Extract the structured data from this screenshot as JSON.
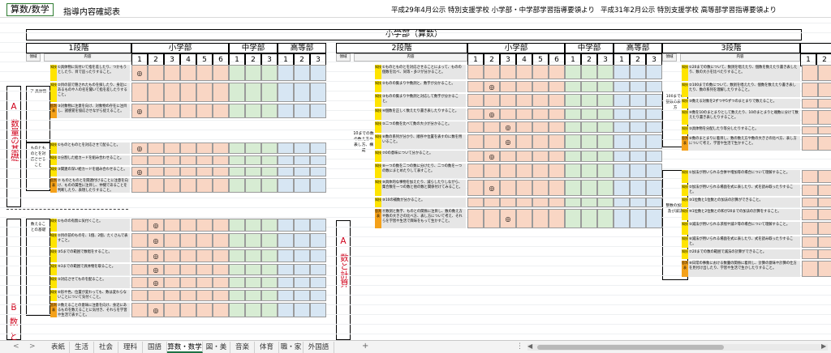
{
  "header": {
    "tab_label": "算数/数学",
    "doc_title": "指導内容確認表",
    "pub1": "平成29年4月公示  特別支援学校  小学部・中学部学習指導要領より",
    "pub2": "平成31年2月公示  特別支援学校  高等部学習指導要領より"
  },
  "banner": "小学部（算数）",
  "stages": [
    "1段階",
    "2段階",
    "3段階"
  ],
  "levels": {
    "elem": "小学部",
    "mid": "中学部",
    "high": "高等部"
  },
  "grades_elem": [
    "1",
    "2",
    "3",
    "4",
    "5",
    "6"
  ],
  "grades_mid": [
    "1",
    "2",
    "3"
  ],
  "grades_high": [
    "1",
    "2",
    "3"
  ],
  "subhead": {
    "domain": "領域",
    "content": "内容"
  },
  "mark": "◎",
  "domains": {
    "a": {
      "letter": "A",
      "text": "数量の基礎"
    },
    "a2": {
      "letter": "A",
      "text": "数と計算"
    },
    "b": {
      "letter": "B",
      "text": "数と"
    }
  },
  "subs": {
    "a_gutai": "ア 具体物",
    "a_mono": "ものとものとを対応させること",
    "a_kazu": "数えることの基礎",
    "s2_kazu": "10までの数の数え方や表し方、構成",
    "s3_kazu": "100までの整数の表し方",
    "s3_keisan": "整数の加法及び減法"
  },
  "labels": {
    "chishiki": "知技",
    "shiko": "思判表"
  },
  "s1": {
    "r1": "①具体物に気付いて指を差したり、つかもうとしたり、目で追ったりすること。",
    "r2": "②目の前で隠されたものを探したり、身近にあるものや人の名を聞いて指を差したりすること。",
    "r3": "③対象物に注意を向け、対象物の存在に注目し、諸感覚を協応させながら捉えること。",
    "r4": "①ものとものとを対応させて配ること。",
    "r5": "②分割した絵カードを組み合わせること。",
    "r6": "③関連の深い絵カードを組み合わせること。",
    "r7": "⑦ ものとものとを関連付けることに注意を向け、ものの属性に注目し、仲間であることを判断したり、表現したりすること。",
    "r8": "①ものの有無に気付くこと。",
    "r9": "②目の前のものを、1個、2個、たくさんで表すこと。",
    "r10": "③5までの範囲で数唱をすること。",
    "r11": "④3までの範囲で具体物を取ること。",
    "r12": "⑤対応させてものを配ること。",
    "r13": "⑥形や色、位置が変わっても、数は変わらないことについて気付くこと。",
    "r14": "⑦数えることの意味に注意を向け、身近にあるものを数えることに気付き、それらを学習や生活で表すこと。"
  },
  "s2": {
    "r1": "①ものとものとを対応させることによって、ものの個数を比べ、同等・多少が分かること。",
    "r2": "②ものの集まりや数詞と、数字が分かること。",
    "r3": "③ものの集まりや数詞と対応して数字が分かること。",
    "r4": "④個数を正しく数えたり書き表したりすること。",
    "r5": "⑤二つの数を比べて数の大小が分かること。",
    "r6": "⑥数の系列が分かり、順序や位置を表すのに数を用いること。",
    "r7": "⑦0の意味について分かること。",
    "r8": "⑧一つの数を二つの数に分けたり、二つの数を一つの数にまとめたりして表すこと。",
    "r9": "⑨具体的な事物を加えたり、減らしたりしながら、集合数を一つの数と他の数と関係付けてみること。",
    "r10": "⑩10の補数が分かること。",
    "r11": "⑪数詞と数字、ものとの関係に注目し、数の数え方や数の大きさの比べ方、表し方について考え、それらを学習や生活で興味をもって生かすこと。"
  },
  "s3": {
    "r1": "①20までの数について、数詞を唱えたり、個数を数えたり書き表したり、数の大小を比べたりすること。",
    "r2": "②100までの数について、数詞を唱えたり、個数を数えたり書き表したり、数の系列を理解したりすること。",
    "r3": "③数える対象を2ずつや5ずつのまとまりで数えること。",
    "r4": "④数を10のまとまりとして数えたり、10のまとまりと端数に分けて数えたり書き表したりすること。",
    "r5": "⑤具体物を分配したり等分したりすること。",
    "r6": "⑥数のまとまりに着目し、数の数え方や数の大きさの比べ方、表し方について考え、学習や生活で生かすこと。",
    "r7": "①加法が用いられる合併や増加等の場合について理解すること。",
    "r8": "②加法が用いられる場面を式に表したり、式を読み取ったりすること。",
    "r9": "③1位数と1位数との加法の計算ができること。",
    "r10": "④1位数と2位数との和が20までの加法の計算をすること。",
    "r11": "⑤減法が用いられる求残や減少等の場合について理解すること。",
    "r12": "⑥減法が用いられる場面を式に表したり、式を読み取ったりすること。",
    "r13": "⑦20までの数の範囲で減法の計算ができること。",
    "r14": "⑧日常の事象における数量の関係に着目し、計算の意味や計算の仕方を見付け出したり、学習や生活で生かしたりすること。"
  },
  "tabs": [
    "表紙",
    "生活",
    "社会",
    "理科",
    "国語",
    "算数・数学",
    "図・美",
    "音楽",
    "体育",
    "職・家",
    "外国語"
  ],
  "active_tab": "算数・数学",
  "nav": {
    "prev": "<",
    "next": ">",
    "add": "+",
    "more": "⋮",
    "scroll_left": "◀",
    "scroll_right": "▶"
  }
}
